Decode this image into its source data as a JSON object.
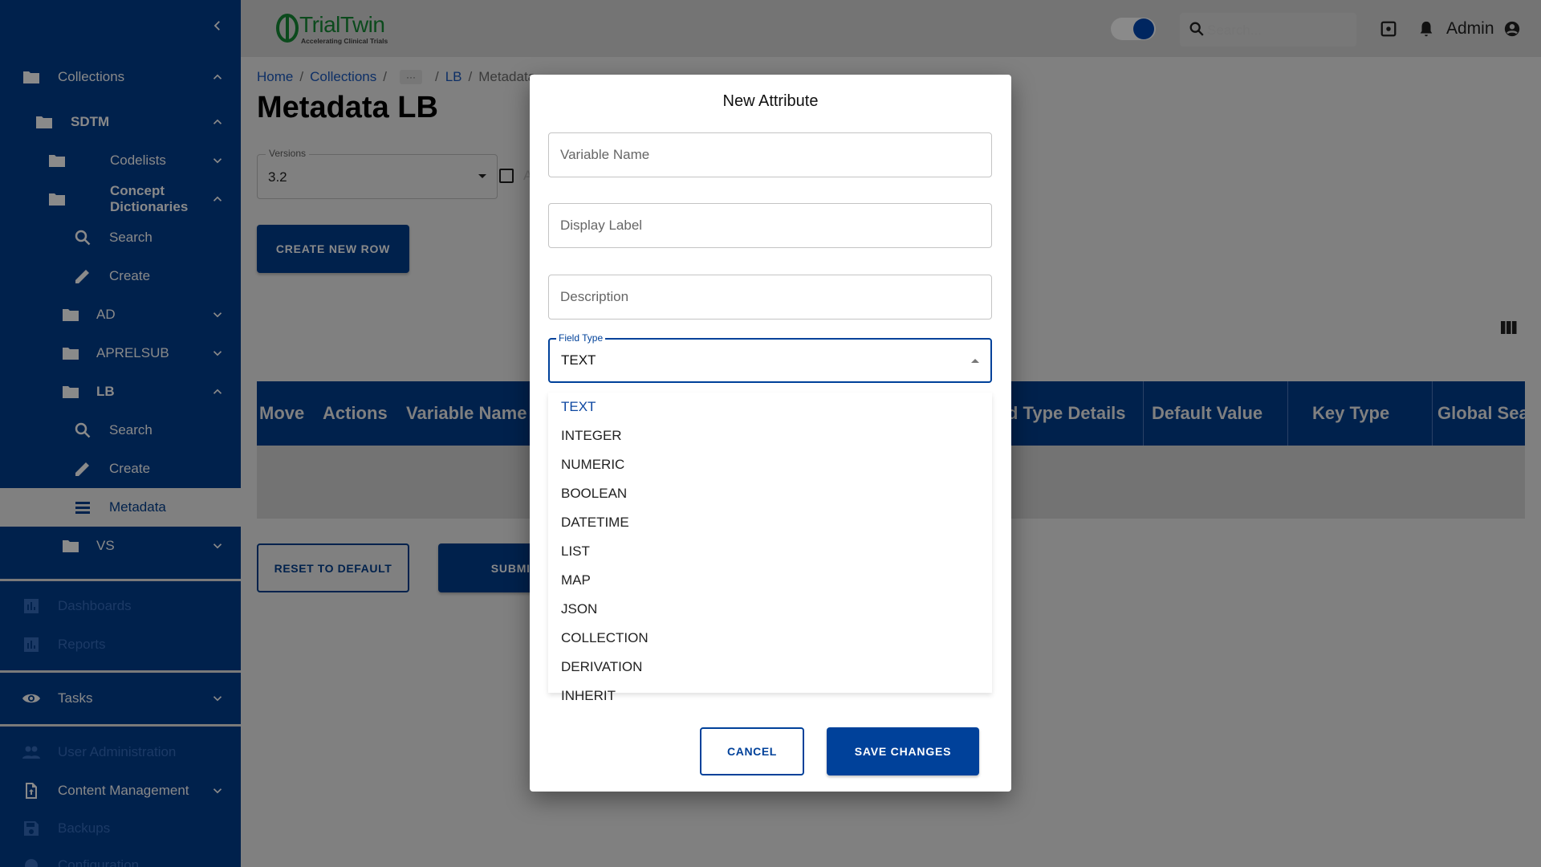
{
  "header": {
    "logo_name": "TrialTwin",
    "logo_tagline": "Accelerating Clinical Trials",
    "search_placeholder": "Search...",
    "user": "Admin",
    "theme_toggle_on": true
  },
  "sidebar": {
    "items": [
      {
        "label": "Collections",
        "icon": "folder-icon",
        "chevron": "up"
      },
      {
        "label": "SDTM",
        "icon": "folder-icon",
        "chevron": "up"
      },
      {
        "label": "Codelists",
        "icon": "folder-icon",
        "chevron": "down"
      },
      {
        "label": "Concept Dictionaries",
        "icon": "folder-icon",
        "chevron": "up"
      },
      {
        "label": "Search",
        "icon": "search-icon"
      },
      {
        "label": "Create",
        "icon": "pencil-icon"
      },
      {
        "label": "AD",
        "icon": "folder-icon",
        "chevron": "down"
      },
      {
        "label": "APRELSUB",
        "icon": "folder-icon",
        "chevron": "down"
      },
      {
        "label": "LB",
        "icon": "folder-icon",
        "chevron": "up"
      },
      {
        "label": "Search",
        "icon": "search-icon"
      },
      {
        "label": "Create",
        "icon": "pencil-icon"
      },
      {
        "label": "Metadata",
        "icon": "list-icon",
        "active": true
      },
      {
        "label": "VS",
        "icon": "folder-icon",
        "chevron": "down"
      },
      {
        "label": "Dashboards",
        "icon": "chart-icon",
        "disabled": true
      },
      {
        "label": "Reports",
        "icon": "chart-icon",
        "disabled": true
      },
      {
        "label": "Tasks",
        "icon": "eye-icon",
        "chevron": "down"
      },
      {
        "label": "User Administration",
        "icon": "people-icon",
        "disabled": true
      },
      {
        "label": "Content Management",
        "icon": "file-upload-icon",
        "chevron": "down"
      },
      {
        "label": "Backups",
        "icon": "save-icon",
        "disabled": true
      },
      {
        "label": "Configuration",
        "icon": "gear-icon",
        "disabled": true
      }
    ]
  },
  "breadcrumb": {
    "home": "Home",
    "collections": "Collections",
    "ellipsis": "···",
    "lb": "LB",
    "current": "Metadata",
    "sep": "/"
  },
  "page": {
    "title": "Metadata LB",
    "versions_label": "Versions",
    "versions_value": "3.2",
    "checkbox_label": "A",
    "create_row": "CREATE NEW ROW",
    "reset": "RESET TO DEFAULT",
    "submit": "SUBMIT"
  },
  "table": {
    "columns": [
      "Move",
      "Actions",
      "Variable Name",
      "d Type Details",
      "Default Value",
      "Key Type",
      "Global Sea"
    ]
  },
  "modal": {
    "title": "New Attribute",
    "variable_name_placeholder": "Variable Name",
    "display_label_placeholder": "Display Label",
    "description_placeholder": "Description",
    "field_type_label": "Field Type",
    "field_type_value": "TEXT",
    "options": [
      "TEXT",
      "INTEGER",
      "NUMERIC",
      "BOOLEAN",
      "DATETIME",
      "LIST",
      "MAP",
      "JSON",
      "COLLECTION",
      "DERIVATION",
      "INHERIT"
    ],
    "cancel": "CANCEL",
    "save": "SAVE CHANGES"
  },
  "colors": {
    "sidebar": "#00214c",
    "accent": "#00419a",
    "selected_option": "#0d47a1"
  }
}
